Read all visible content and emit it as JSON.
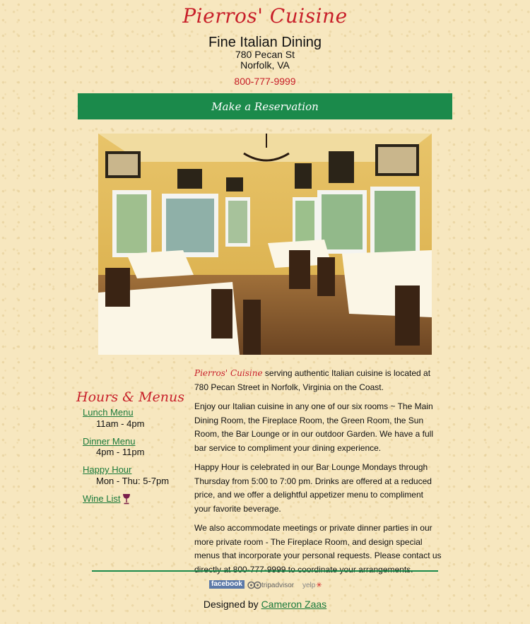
{
  "header": {
    "brand": "Pierros' Cuisine",
    "tagline": "Fine Italian Dining",
    "address_line1": "780 Pecan St",
    "address_line2": "Norfolk, VA",
    "phone": "800-777-9999"
  },
  "reservation": {
    "label": "Make a Reservation"
  },
  "photo": {
    "alt": "Dining room with tables and windows"
  },
  "sidebar": {
    "title": "Hours & Menus",
    "items": [
      {
        "label": "Lunch Menu",
        "hours": "11am - 4pm"
      },
      {
        "label": "Dinner Menu",
        "hours": "4pm - 11pm"
      },
      {
        "label": "Happy Hour",
        "hours": "Mon - Thu: 5-7pm"
      },
      {
        "label": "Wine List",
        "icon": "wine-glass-icon"
      }
    ]
  },
  "content": {
    "brand_inline": "Pierros' Cuisine",
    "p1_rest": " serving authentic Italian cuisine is located at 780 Pecan Street in Norfolk, Virginia on the Coast.",
    "p2": "Enjoy our Italian cuisine in any one of our six rooms ~  The Main Dining Room, the Fireplace Room, the Green Room, the Sun Room, the Bar Lounge or in our outdoor Garden. We have a full bar service to compliment your dining experience.",
    "p3": "Happy Hour is celebrated in our Bar Lounge Mondays through Thursday from 5:00 to 7:00 pm.  Drinks are offered at a reduced price, and we offer a delightful appetizer menu to compliment your favorite beverage.",
    "p4": "We also accommodate meetings or private dinner parties in our more private room - The Fireplace Room, and design special menus that incorporate your personal requests.  Please contact us directly at 800-777-9999 to coordinate your arrangements."
  },
  "social": {
    "facebook": "facebook",
    "tripadvisor": "tripadvisor",
    "yelp": "yelp"
  },
  "footer": {
    "prefix": "Designed by ",
    "designer": "Cameron Zaas"
  },
  "colors": {
    "background": "#f7e7bf",
    "brand_red": "#c8202a",
    "accent_green": "#1b8a4b",
    "link_green": "#1b7a3b"
  }
}
